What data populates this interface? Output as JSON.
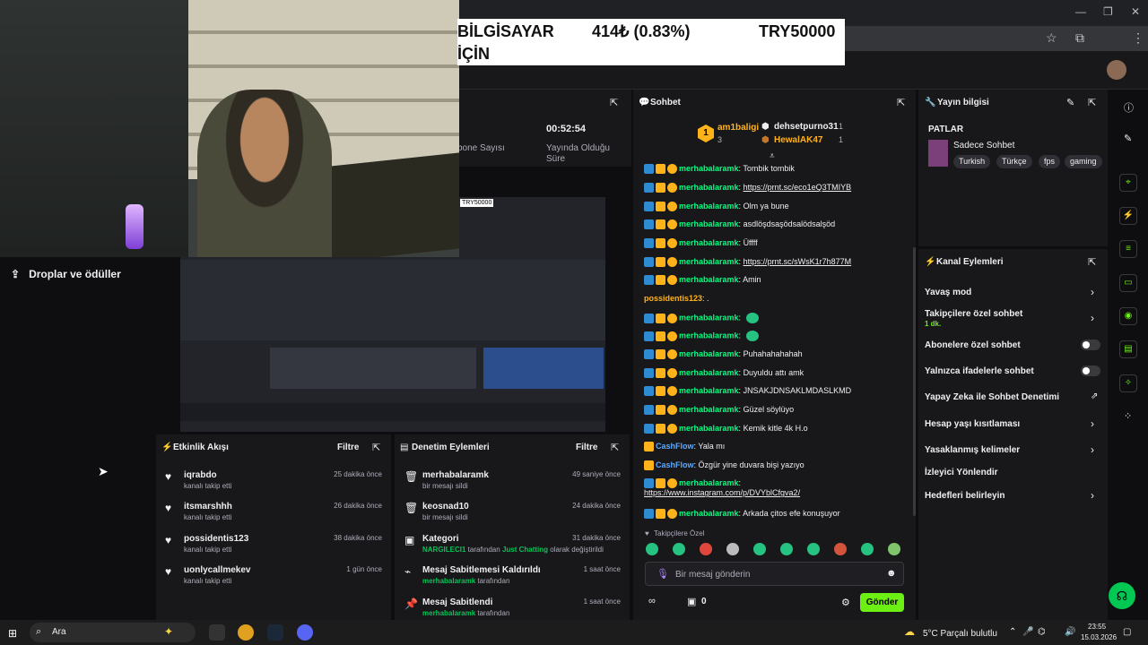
{
  "ticker": {
    "name": "BİLGİSAYAR",
    "name2": "İÇİN",
    "change": "414₺ (0.83%)",
    "goal": "TRY50000"
  },
  "stats": {
    "subs_label": "bone Sayısı",
    "uptime_value": "00:52:54",
    "uptime_label": "Yayında Olduğu Süre"
  },
  "sidebar": {
    "drops_label": "Droplar ve ödüller"
  },
  "video": {
    "overlay_label": "TRY50000"
  },
  "activity": {
    "title": "Etkinlik Akışı",
    "filter": "Filtre",
    "items": [
      {
        "name": "iqrabdo",
        "sub": "kanalı takip etti",
        "time": "25 dakika önce"
      },
      {
        "name": "itsmarshhh",
        "sub": "kanalı takip etti",
        "time": "26 dakika önce"
      },
      {
        "name": "possidentis123",
        "sub": "kanalı takip etti",
        "time": "38 dakika önce"
      },
      {
        "name": "uonlycallmekev",
        "sub": "kanalı takip etti",
        "time": "1 gün önce"
      }
    ]
  },
  "moderation": {
    "title": "Denetim Eylemleri",
    "filter": "Filtre",
    "items": [
      {
        "name": "merhabalaramk",
        "sub": "bir mesajı sildi",
        "time": "49 saniye önce"
      },
      {
        "name": "keosnad10",
        "sub": "bir mesajı sildi",
        "time": "24 dakika önce"
      },
      {
        "name": "Kategori",
        "sub_user": "NARGILECI1",
        "sub_mid": " tarafından ",
        "sub_cat": "Just Chatting",
        "sub_end": " olarak değiştirildi",
        "time": "31 dakika önce"
      },
      {
        "name": "Mesaj Sabitlemesi Kaldırıldı",
        "sub_user": "merhabalaramk",
        "sub_end": " tarafından",
        "time": "1 saat önce"
      },
      {
        "name": "Mesaj Sabitlendi",
        "sub_user": "merhabalaramk",
        "sub_end": " tarafından",
        "time": "1 saat önce"
      }
    ]
  },
  "chat": {
    "title": "Sohbet",
    "leaders": [
      {
        "rank": "1",
        "name": "am1baligi",
        "count": "3"
      },
      {
        "name": "dehsetpurno31",
        "count": "1"
      },
      {
        "name": "HewalAK47",
        "count": "1"
      }
    ],
    "messages": [
      {
        "user": "merhabalaramk",
        "text": "Tombik tombik"
      },
      {
        "user": "merhabalaramk",
        "text": "https://prnt.sc/eco1eQ3TMIYB",
        "link": true
      },
      {
        "user": "merhabalaramk",
        "text": "Olm ya bune"
      },
      {
        "user": "merhabalaramk",
        "text": "asdlöşdsaşödsalödsalşöd"
      },
      {
        "user": "merhabalaramk",
        "text": "Üffff"
      },
      {
        "user": "merhabalaramk",
        "text": "https://prnt.sc/sWsK1r7h877M",
        "link": true
      },
      {
        "user": "merhabalaramk",
        "text": "Amin"
      },
      {
        "user": "possidentis123",
        "text": "."
      },
      {
        "user": "merhabalaramk",
        "text": ""
      },
      {
        "user": "merhabalaramk",
        "text": ""
      },
      {
        "user": "merhabalaramk",
        "text": "Puhahahahahah"
      },
      {
        "user": "merhabalaramk",
        "text": "Duyuldu attı amk"
      },
      {
        "user": "merhabalaramk",
        "text": "JNSAKJDNSAKLMDASLKMD"
      },
      {
        "user": "merhabalaramk",
        "text": "Güzel söylüyo"
      },
      {
        "user": "merhabalaramk",
        "text": "Kemik kitle 4k H.o"
      },
      {
        "user": "CashFlow",
        "text": "Yala mı"
      },
      {
        "user": "CashFlow",
        "text": "Özgür yine duvara bişi yazıyo"
      },
      {
        "user": "merhabalaramk",
        "text": "https://www.instagram.com/p/DVYblCfgva2/",
        "link": true
      },
      {
        "user": "merhabalaramk",
        "text": "Arkada çitos efe konuşuyor"
      }
    ],
    "followers_only": "Takipçilere Özel",
    "input_placeholder": "Bir mesaj gönderin",
    "points": "0",
    "send": "Gönder"
  },
  "stream_info": {
    "title": "Yayın bilgisi",
    "stream_title": "PATLAR",
    "category": "Sadece Sohbet",
    "tags": [
      "Turkish",
      "Türkçe",
      "fps",
      "gaming"
    ]
  },
  "channel_actions": {
    "title": "Kanal Eylemleri",
    "slow_mode": "Yavaş mod",
    "followers_chat": "Takipçilere özel sohbet",
    "followers_chat_sub": "1 dk.",
    "subs_chat": "Abonelere özel sohbet",
    "emote_chat": "Yalnızca ifadelerle sohbet",
    "ai_mod": "Yapay Zeka ile Sohbet Denetimi",
    "age_limit": "Hesap yaşı kısıtlaması",
    "banned_words": "Yasaklanmış kelimeler",
    "redirect": "İzleyici Yönlendir",
    "goals": "Hedefleri belirleyin"
  },
  "taskbar": {
    "search": "Ara",
    "weather": "5°C  Parçalı bulutlu",
    "time": "23:55",
    "date": "15.03.2026"
  },
  "colors": {
    "accent_green": "#6cf014",
    "user_green": "#00ff7f",
    "link_blue": "#5aa9ff",
    "gold": "#ffb31a"
  }
}
